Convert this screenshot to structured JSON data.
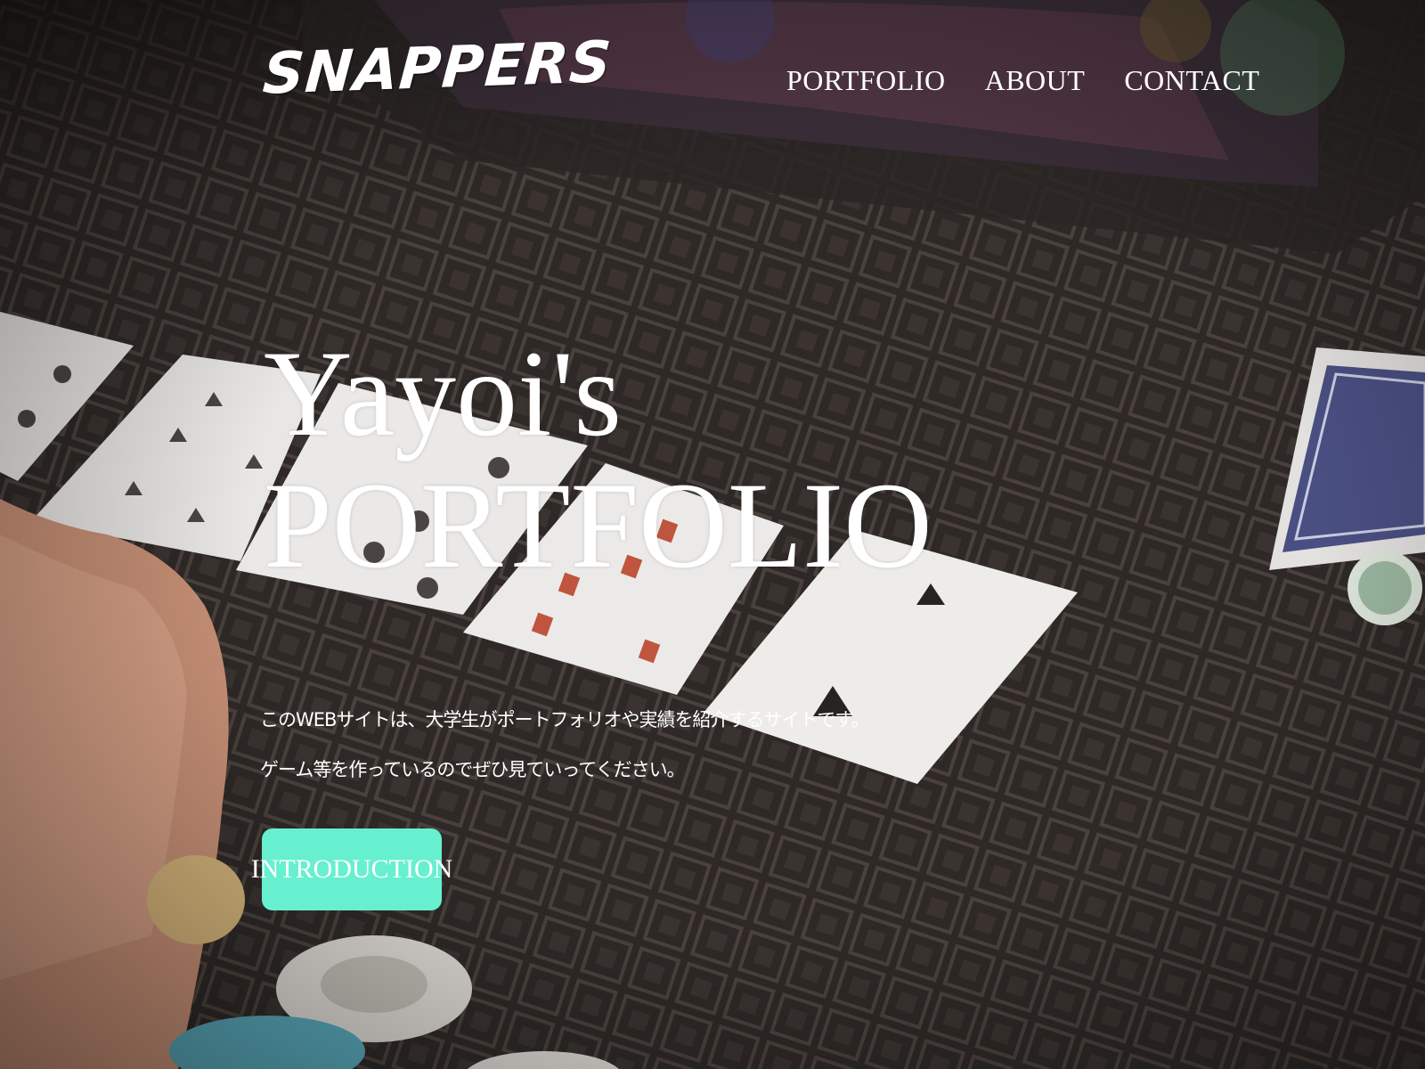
{
  "header": {
    "logo_text": "SNAPPERS",
    "nav": [
      {
        "label": "PORTFOLIO"
      },
      {
        "label": "ABOUT"
      },
      {
        "label": "CONTACT"
      }
    ]
  },
  "hero": {
    "title_line1": "Yayoi's",
    "title_line2": "PORTFOLIO",
    "description_line1": "このWEBサイトは、大学生がポートフォリオや実績を紹介するサイトです。",
    "description_line2": "ゲーム等を作っているのでぜひ見ていってください。",
    "cta_label": "INTRODUCTION"
  },
  "colors": {
    "cta_background": "#67f0cf",
    "text": "#ffffff",
    "table_felt": "#2f2a28"
  }
}
